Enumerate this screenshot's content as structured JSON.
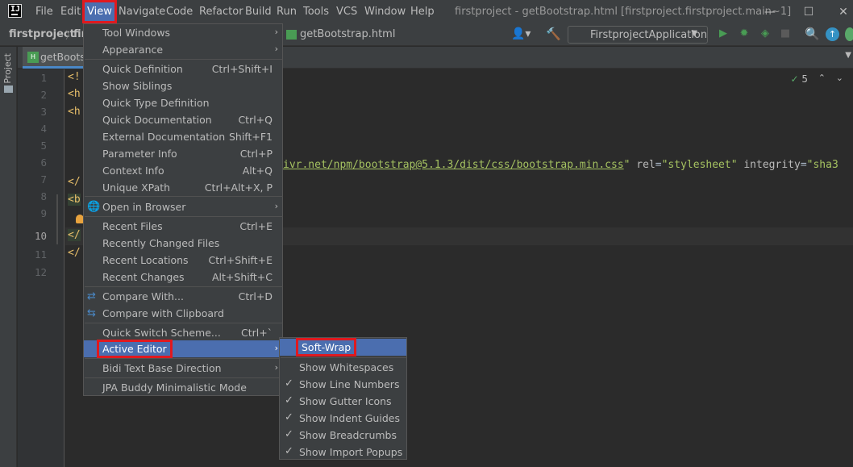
{
  "menubar": {
    "items": [
      "File",
      "Edit",
      "View",
      "Navigate",
      "Code",
      "Refactor",
      "Build",
      "Run",
      "Tools",
      "VCS",
      "Window",
      "Help"
    ],
    "window_title": "firstproject - getBootstrap.html [firstproject.firstproject.main~1]",
    "app_icon_text": "IJ"
  },
  "window_controls": {
    "minimize": "—",
    "maximize": "☐",
    "close": "✕"
  },
  "navbar": {
    "project": "firstproject",
    "separator": "〉",
    "second_crumb": "fir",
    "file": "getBootstrap.html",
    "run_config": "FirstprojectApplication",
    "run_config_caret": "▼"
  },
  "toolbar_icons": {
    "user": "👤▾",
    "hammer": "🔨",
    "run": "▶",
    "debug": "✹",
    "coverage": "◈",
    "stop": "■",
    "search": "🔍",
    "update": "↑"
  },
  "tool_strip": {
    "project_label": "Project"
  },
  "editor_tab": {
    "label": "getBootstrap.html",
    "icon_text": "H",
    "scroll_caret": "▼"
  },
  "editor": {
    "line_numbers": [
      "1",
      "2",
      "3",
      "4",
      "5",
      "6",
      "7",
      "8",
      "9",
      "10",
      "11",
      "12"
    ],
    "current_line": "10",
    "fragments": [
      "<!",
      "<h",
      "<h",
      "</",
      "<b",
      "</",
      "</"
    ],
    "line7_url": "jsdelivr.net/npm/bootstrap@5.1.3/dist/css/bootstrap.min.css",
    "line7_url_visible": "ivr.net/npm/bootstrap@5.1.3/dist/css/bootstrap.min.css",
    "line7_q1": "\" ",
    "line7_rel_attr": "rel",
    "line7_eq1": "=",
    "line7_rel_val": "\"stylesheet\"",
    "line7_space": " ",
    "line7_int_attr": "integrity",
    "line7_eq2": "=",
    "line7_int_val": "\"sha3",
    "inspection_mark": "✓",
    "inspection_count": "5",
    "nav_up": "⌃",
    "nav_down": "⌄"
  },
  "view_menu": {
    "items": [
      {
        "label": "Tool Windows",
        "shortcut": "",
        "submenu": true
      },
      {
        "label": "Appearance",
        "shortcut": "",
        "submenu": true
      },
      {
        "label": "Quick Definition",
        "shortcut": "Ctrl+Shift+I"
      },
      {
        "label": "Show Siblings",
        "shortcut": ""
      },
      {
        "label": "Quick Type Definition",
        "shortcut": ""
      },
      {
        "label": "Quick Documentation",
        "shortcut": "Ctrl+Q"
      },
      {
        "label": "External Documentation",
        "shortcut": "Shift+F1"
      },
      {
        "label": "Parameter Info",
        "shortcut": "Ctrl+P"
      },
      {
        "label": "Context Info",
        "shortcut": "Alt+Q"
      },
      {
        "label": "Unique XPath",
        "shortcut": "Ctrl+Alt+X, P"
      },
      {
        "label": "Open in Browser",
        "shortcut": "",
        "submenu": true,
        "icon": "globe-icon"
      },
      {
        "label": "Recent Files",
        "shortcut": "Ctrl+E"
      },
      {
        "label": "Recently Changed Files",
        "shortcut": ""
      },
      {
        "label": "Recent Locations",
        "shortcut": "Ctrl+Shift+E"
      },
      {
        "label": "Recent Changes",
        "shortcut": "Alt+Shift+C"
      },
      {
        "label": "Compare With...",
        "shortcut": "Ctrl+D",
        "icon": "compare-icon"
      },
      {
        "label": "Compare with Clipboard",
        "shortcut": "",
        "icon": "compare-clipboard-icon"
      },
      {
        "label": "Quick Switch Scheme...",
        "shortcut": "Ctrl+`"
      },
      {
        "label": "Active Editor",
        "shortcut": "",
        "submenu": true,
        "selected": true
      },
      {
        "label": "Bidi Text Base Direction",
        "shortcut": "",
        "submenu": true
      },
      {
        "label": "JPA Buddy Minimalistic Mode",
        "shortcut": ""
      }
    ],
    "submenu_arrow": "›",
    "globe_glyph": "🌐",
    "compare_glyph": "⇄",
    "compare_clip_glyph": "⇆"
  },
  "active_editor_menu": {
    "items": [
      {
        "label": "Soft-Wrap",
        "checked": false,
        "selected": true
      },
      {
        "label": "Show Whitespaces",
        "checked": false
      },
      {
        "label": "Show Line Numbers",
        "checked": true
      },
      {
        "label": "Show Gutter Icons",
        "checked": true
      },
      {
        "label": "Show Indent Guides",
        "checked": true
      },
      {
        "label": "Show Breadcrumbs",
        "checked": true
      },
      {
        "label": "Show Import Popups",
        "checked": true
      }
    ],
    "check_glyph": "✓"
  },
  "colors": {
    "background": "#2b2b2b",
    "chrome": "#3c3f41",
    "selection": "#4b6eaf",
    "highlight_box": "#e0191f",
    "run_green": "#499c54"
  }
}
